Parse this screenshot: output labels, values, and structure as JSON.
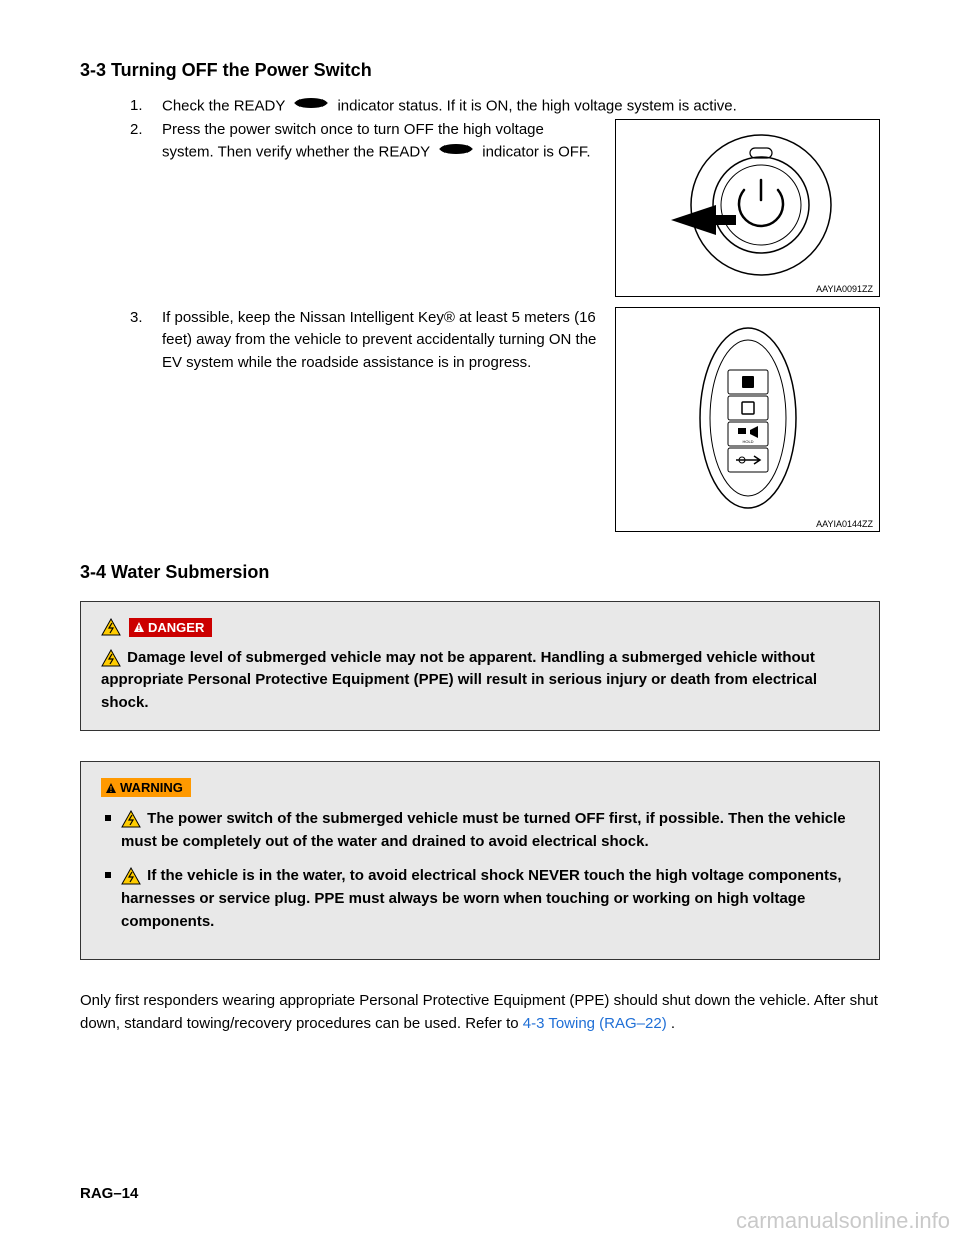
{
  "section33": {
    "heading": "3-3  Turning OFF the Power Switch",
    "step1_num": "1.",
    "step1_textA": "Check the READY ",
    "step1_textB": " indicator status. If it is ON, the high voltage system is active.",
    "step2_num": "2.",
    "step2_text": "Press the power switch once to turn OFF the high voltage system. Then verify whether the READY indicator is OFF.",
    "fig1_caption": "AAYIA0091ZZ",
    "step3_num": "3.",
    "step3_text": " If possible, keep the Nissan Intelligent Key® at least 5 meters (16 feet) away from the vehicle to prevent accidentally turning ON the EV system while the roadside assistance is in progress.",
    "fig2_caption": "AAYIA0144ZZ"
  },
  "section34": {
    "heading": "3-4  Water Submersion",
    "danger_label": "DANGER",
    "danger_text": "Damage level of submerged vehicle may not be apparent. Handling a submerged vehicle without appropriate Personal Protective Equipment (PPE) will result in serious injury or death from electrical shock.",
    "warning_label": "WARNING",
    "warning_items": [
      "The power switch of the submerged vehicle must be turned OFF first, if possible. Then the vehicle must be completely out of the water and drained to avoid electrical shock.",
      "If the vehicle is in the water, to avoid electrical shock NEVER touch the high voltage components, harnesses or service plug. PPE must always be worn when touching or working on high voltage components."
    ],
    "para_text": "Only first responders wearing appropriate Personal Protective Equipment (PPE) should shut down the vehicle. After shut down, standard towing/recovery procedures can be used. Refer to ",
    "link_text": "4-3  Towing (RAG–22)",
    "para_suffix": " ."
  },
  "footer": "RAG–14",
  "watermark": "carmanualsonline.info"
}
